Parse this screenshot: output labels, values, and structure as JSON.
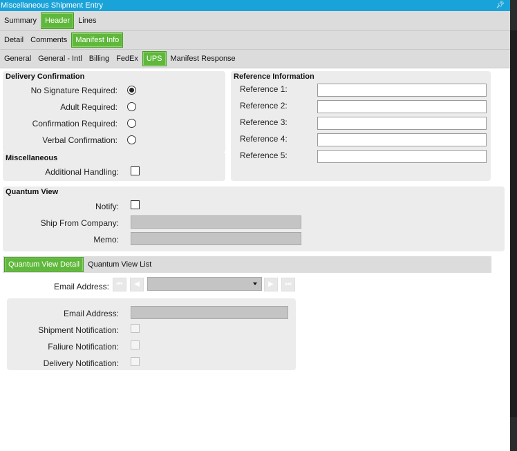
{
  "window": {
    "title": "Miscellaneous Shipment Entry"
  },
  "tabs_row1": [
    {
      "label": "Summary",
      "active": false
    },
    {
      "label": "Header",
      "active": true
    },
    {
      "label": "Lines",
      "active": false
    }
  ],
  "tabs_row2": [
    {
      "label": "Detail",
      "active": false
    },
    {
      "label": "Comments",
      "active": false
    },
    {
      "label": "Manifest Info",
      "active": true
    }
  ],
  "tabs_row3": [
    {
      "label": "General",
      "active": false
    },
    {
      "label": "General - Intl",
      "active": false
    },
    {
      "label": "Billing",
      "active": false
    },
    {
      "label": "FedEx",
      "active": false
    },
    {
      "label": "UPS",
      "active": true
    },
    {
      "label": "Manifest Response",
      "active": false
    }
  ],
  "delivery_confirmation": {
    "title": "Delivery Confirmation",
    "options": [
      {
        "label": "No Signature Required:",
        "checked": true
      },
      {
        "label": "Adult Required:",
        "checked": false
      },
      {
        "label": "Confirmation Required:",
        "checked": false
      },
      {
        "label": "Verbal Confirmation:",
        "checked": false
      }
    ]
  },
  "miscellaneous": {
    "title": "Miscellaneous",
    "additional_handling_label": "Additional Handling:"
  },
  "reference_information": {
    "title": "Reference Information",
    "fields": [
      {
        "label": "Reference 1:",
        "value": ""
      },
      {
        "label": "Reference 2:",
        "value": ""
      },
      {
        "label": "Reference 3:",
        "value": ""
      },
      {
        "label": "Reference 4:",
        "value": ""
      },
      {
        "label": "Reference 5:",
        "value": ""
      }
    ]
  },
  "quantum_view": {
    "title": "Quantum View",
    "notify_label": "Notify:",
    "ship_from_company_label": "Ship From Company:",
    "ship_from_company_value": "",
    "memo_label": "Memo:",
    "memo_value": ""
  },
  "quantum_tabs": [
    {
      "label": "Quantum View Detail",
      "active": true
    },
    {
      "label": "Quantum View List",
      "active": false
    }
  ],
  "quantum_detail": {
    "email_nav_label": "Email Address:",
    "email_select_value": "",
    "email_label": "Email Address:",
    "email_value": "",
    "shipment_notification_label": "Shipment Notification:",
    "failure_notification_label": "Faliure Notification:",
    "delivery_notification_label": "Delivery Notification:"
  },
  "icons": {
    "pin": "pin-icon",
    "nav_first": "first-record-icon",
    "nav_prev": "previous-record-icon",
    "nav_next": "next-record-icon",
    "nav_last": "last-record-icon",
    "dropdown": "chevron-down-icon"
  },
  "colors": {
    "titlebar": "#1aa3d9",
    "active_tab": "#5fb83b",
    "panel": "#ececec",
    "tab_strip": "#dcdcdc",
    "disabled_field": "#c4c4c4"
  }
}
